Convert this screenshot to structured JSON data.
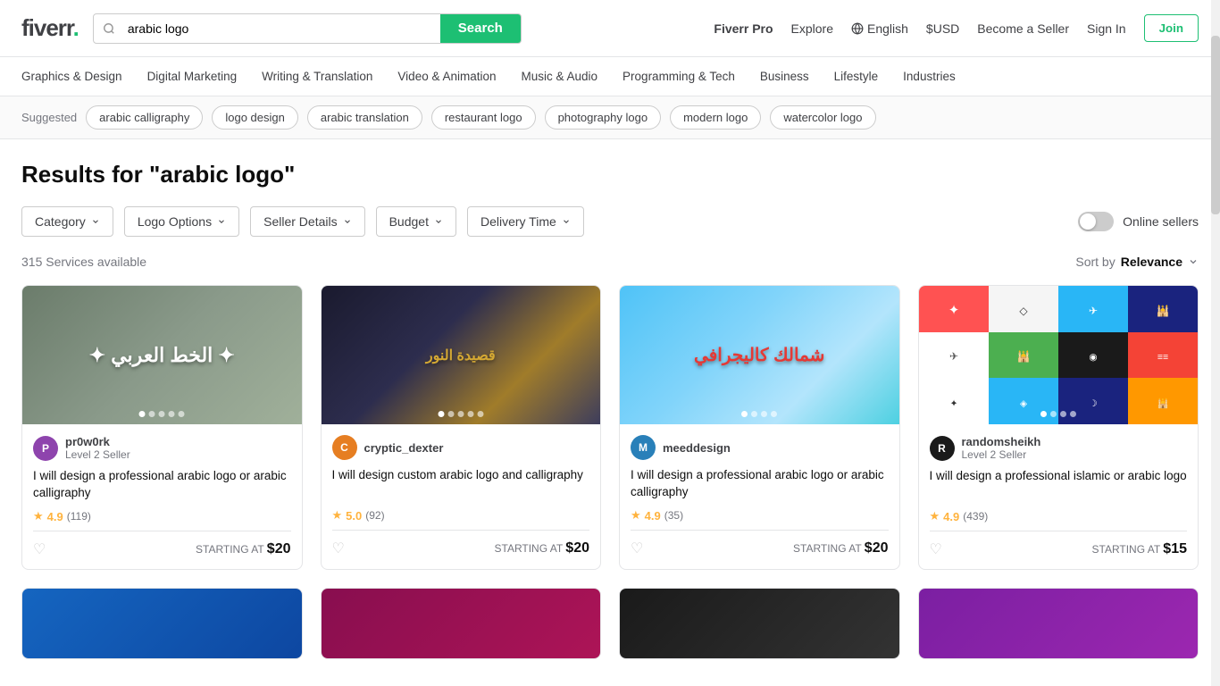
{
  "header": {
    "logo_text": "fiverr",
    "logo_dot": ".",
    "search_placeholder": "arabic logo",
    "search_button_label": "Search",
    "nav": {
      "fiverr_pro": "Fiverr Pro",
      "explore": "Explore",
      "language": "English",
      "currency": "$USD",
      "become_seller": "Become a Seller",
      "sign_in": "Sign In",
      "join": "Join"
    }
  },
  "category_nav": {
    "items": [
      "Graphics & Design",
      "Digital Marketing",
      "Writing & Translation",
      "Video & Animation",
      "Music & Audio",
      "Programming & Tech",
      "Business",
      "Lifestyle",
      "Industries"
    ]
  },
  "suggested": {
    "label": "Suggested",
    "tags": [
      "arabic calligraphy",
      "logo design",
      "arabic translation",
      "restaurant logo",
      "photography logo",
      "modern logo",
      "watercolor logo"
    ]
  },
  "results": {
    "title": "Results for \"arabic logo\"",
    "count": "315 Services available",
    "sort_label": "Sort by",
    "sort_value": "Relevance"
  },
  "filters": {
    "category_label": "Category",
    "logo_options_label": "Logo Options",
    "seller_details_label": "Seller Details",
    "budget_label": "Budget",
    "delivery_time_label": "Delivery Time",
    "online_sellers_label": "Online sellers"
  },
  "gigs": [
    {
      "id": 1,
      "seller_username": "pr0w0rk",
      "seller_level": "Level 2 Seller",
      "title": "I will design a professional arabic logo or arabic calligraphy",
      "rating": "4.9",
      "reviews": "119",
      "starting_price": "$20",
      "thumb_type": "green"
    },
    {
      "id": 2,
      "seller_username": "cryptic_dexter",
      "seller_level": "",
      "title": "I will design custom arabic logo and calligraphy",
      "rating": "5.0",
      "reviews": "92",
      "starting_price": "$20",
      "thumb_type": "dark"
    },
    {
      "id": 3,
      "seller_username": "meeddesign",
      "seller_level": "",
      "title": "I will design a professional arabic logo or arabic calligraphy",
      "rating": "4.9",
      "reviews": "35",
      "starting_price": "$20",
      "thumb_type": "teal"
    },
    {
      "id": 4,
      "seller_username": "randomsheikh",
      "seller_level": "Level 2 Seller",
      "title": "I will design a professional islamic or arabic logo",
      "rating": "4.9",
      "reviews": "439",
      "starting_price": "$15",
      "thumb_type": "grid"
    }
  ],
  "partial_cards": [
    {
      "id": 5,
      "color": "blue-dark"
    },
    {
      "id": 6,
      "color": "maroon"
    },
    {
      "id": 7,
      "color": "black"
    },
    {
      "id": 8,
      "color": "purple"
    }
  ]
}
